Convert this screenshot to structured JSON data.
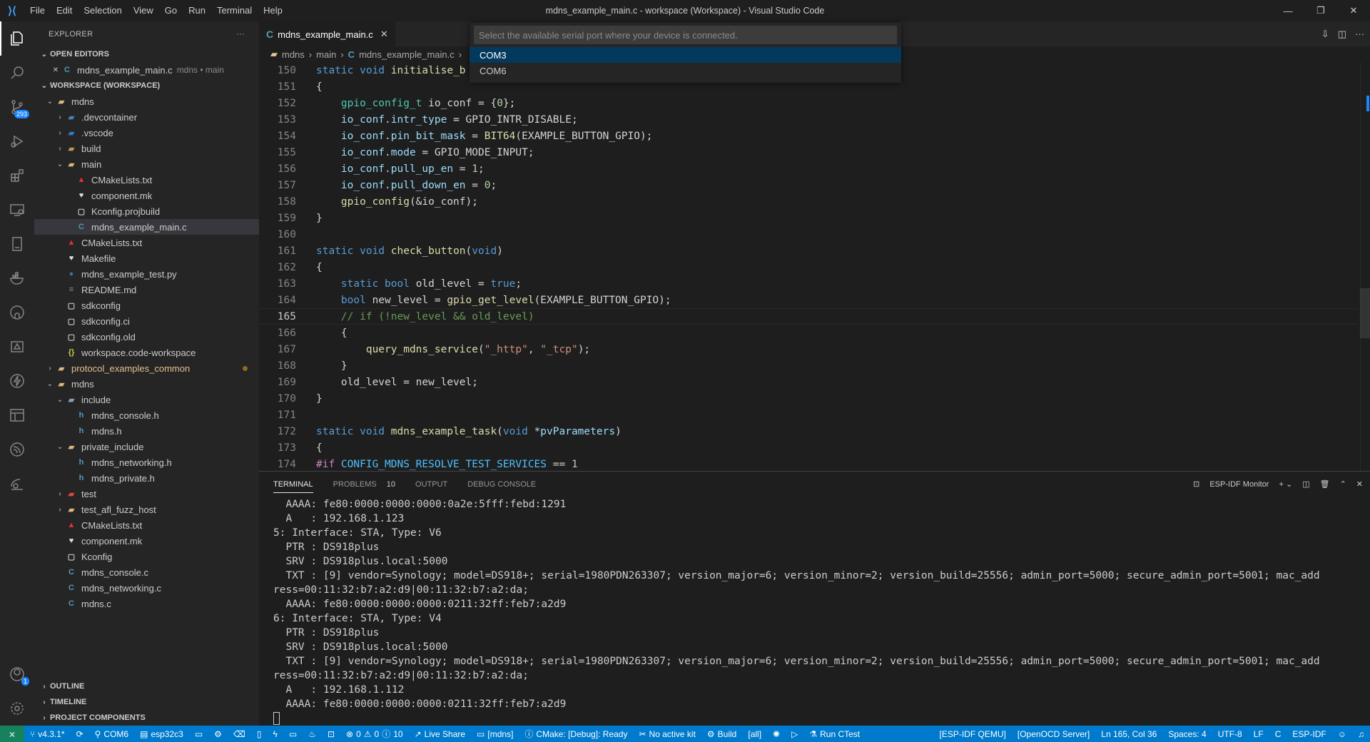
{
  "window": {
    "title": "mdns_example_main.c - workspace (Workspace) - Visual Studio Code",
    "menu": [
      "File",
      "Edit",
      "Selection",
      "View",
      "Go",
      "Run",
      "Terminal",
      "Help"
    ],
    "controls": [
      "—",
      "❐",
      "✕"
    ]
  },
  "activity": {
    "scm_badge": "293",
    "account_badge": "1"
  },
  "sidebar": {
    "title": "EXPLORER",
    "more": "···",
    "open_editors_label": "OPEN EDITORS",
    "open_editor": {
      "name": "mdns_example_main.c",
      "detail": "mdns • main"
    },
    "workspace_label": "WORKSPACE (WORKSPACE)",
    "tree": [
      {
        "label": "mdns",
        "indent": 1,
        "chev": "⌄",
        "icon": "folder-icon",
        "glyph": "▰",
        "color": "#dcb67a"
      },
      {
        "label": ".devcontainer",
        "indent": 2,
        "chev": "›",
        "icon": "folder-icon",
        "glyph": "▰",
        "color": "#4a7fbf"
      },
      {
        "label": ".vscode",
        "indent": 2,
        "chev": "›",
        "icon": "folder-icon",
        "glyph": "▰",
        "color": "#2f7bc6"
      },
      {
        "label": "build",
        "indent": 2,
        "chev": "›",
        "icon": "folder-icon",
        "glyph": "▰",
        "color": "#c09553"
      },
      {
        "label": "main",
        "indent": 2,
        "chev": "⌄",
        "icon": "folder-open-icon",
        "glyph": "▰",
        "color": "#dcb67a"
      },
      {
        "label": "CMakeLists.txt",
        "indent": 3,
        "chev": "",
        "icon": "cmake-icon",
        "glyph": "▲",
        "color": "#e4312a"
      },
      {
        "label": "component.mk",
        "indent": 3,
        "chev": "",
        "icon": "makefile-icon",
        "glyph": "♥",
        "color": "#e0e0e0"
      },
      {
        "label": "Kconfig.projbuild",
        "indent": 3,
        "chev": "",
        "icon": "file-icon",
        "glyph": "▢",
        "color": "#cccccc"
      },
      {
        "label": "mdns_example_main.c",
        "indent": 3,
        "chev": "",
        "icon": "c-file-icon",
        "glyph": "C",
        "color": "#519aba",
        "selected": true
      },
      {
        "label": "CMakeLists.txt",
        "indent": 2,
        "chev": "",
        "icon": "cmake-icon",
        "glyph": "▲",
        "color": "#e4312a"
      },
      {
        "label": "Makefile",
        "indent": 2,
        "chev": "",
        "icon": "makefile-icon",
        "glyph": "♥",
        "color": "#e0e0e0"
      },
      {
        "label": "mdns_example_test.py",
        "indent": 2,
        "chev": "",
        "icon": "python-icon",
        "glyph": "●",
        "color": "#3572a5"
      },
      {
        "label": "README.md",
        "indent": 2,
        "chev": "",
        "icon": "markdown-icon",
        "glyph": "≡",
        "color": "#8a8a8a"
      },
      {
        "label": "sdkconfig",
        "indent": 2,
        "chev": "",
        "icon": "file-icon",
        "glyph": "▢",
        "color": "#cccccc"
      },
      {
        "label": "sdkconfig.ci",
        "indent": 2,
        "chev": "",
        "icon": "file-icon",
        "glyph": "▢",
        "color": "#cccccc"
      },
      {
        "label": "sdkconfig.old",
        "indent": 2,
        "chev": "",
        "icon": "file-icon",
        "glyph": "▢",
        "color": "#cccccc"
      },
      {
        "label": "workspace.code-workspace",
        "indent": 2,
        "chev": "",
        "icon": "json-icon",
        "glyph": "{}",
        "color": "#cbcb41"
      },
      {
        "label": "protocol_examples_common",
        "indent": 1,
        "chev": "›",
        "icon": "folder-icon",
        "glyph": "▰",
        "color": "#dcb67a",
        "modified": true
      },
      {
        "label": "mdns",
        "indent": 1,
        "chev": "⌄",
        "icon": "folder-icon",
        "glyph": "▰",
        "color": "#dcb67a"
      },
      {
        "label": "include",
        "indent": 2,
        "chev": "⌄",
        "icon": "folder-open-icon",
        "glyph": "▰",
        "color": "#8aa0b8"
      },
      {
        "label": "mdns_console.h",
        "indent": 3,
        "chev": "",
        "icon": "h-file-icon",
        "glyph": "h",
        "color": "#519aba"
      },
      {
        "label": "mdns.h",
        "indent": 3,
        "chev": "",
        "icon": "h-file-icon",
        "glyph": "h",
        "color": "#519aba"
      },
      {
        "label": "private_include",
        "indent": 2,
        "chev": "⌄",
        "icon": "folder-open-icon",
        "glyph": "▰",
        "color": "#dcb67a"
      },
      {
        "label": "mdns_networking.h",
        "indent": 3,
        "chev": "",
        "icon": "h-file-icon",
        "glyph": "h",
        "color": "#519aba"
      },
      {
        "label": "mdns_private.h",
        "indent": 3,
        "chev": "",
        "icon": "h-file-icon",
        "glyph": "h",
        "color": "#519aba"
      },
      {
        "label": "test",
        "indent": 2,
        "chev": "›",
        "icon": "test-folder-icon",
        "glyph": "▰",
        "color": "#e0483c"
      },
      {
        "label": "test_afl_fuzz_host",
        "indent": 2,
        "chev": "›",
        "icon": "folder-icon",
        "glyph": "▰",
        "color": "#dcb67a"
      },
      {
        "label": "CMakeLists.txt",
        "indent": 2,
        "chev": "",
        "icon": "cmake-icon",
        "glyph": "▲",
        "color": "#e4312a"
      },
      {
        "label": "component.mk",
        "indent": 2,
        "chev": "",
        "icon": "makefile-icon",
        "glyph": "♥",
        "color": "#e0e0e0"
      },
      {
        "label": "Kconfig",
        "indent": 2,
        "chev": "",
        "icon": "file-icon",
        "glyph": "▢",
        "color": "#cccccc"
      },
      {
        "label": "mdns_console.c",
        "indent": 2,
        "chev": "",
        "icon": "c-file-icon",
        "glyph": "C",
        "color": "#519aba"
      },
      {
        "label": "mdns_networking.c",
        "indent": 2,
        "chev": "",
        "icon": "c-file-icon",
        "glyph": "C",
        "color": "#519aba"
      },
      {
        "label": "mdns.c",
        "indent": 2,
        "chev": "",
        "icon": "c-file-icon",
        "glyph": "C",
        "color": "#519aba"
      }
    ],
    "bottom_sections": [
      "OUTLINE",
      "TIMELINE",
      "PROJECT COMPONENTS"
    ]
  },
  "editor": {
    "tab_label": "mdns_example_main.c",
    "breadcrumb": [
      "mdns",
      "main",
      "mdns_example_main.c"
    ],
    "quick_pick": {
      "placeholder": "Select the available serial port where your device is connected.",
      "items": [
        "COM3",
        "COM6"
      ]
    },
    "current_line": 165,
    "lines": [
      {
        "n": 150,
        "t": [
          [
            "kw",
            "static "
          ],
          [
            "kw",
            "void "
          ],
          [
            "fn",
            "initialise_b"
          ]
        ]
      },
      {
        "n": 151,
        "t": [
          [
            "wt",
            "{"
          ]
        ]
      },
      {
        "n": 152,
        "t": [
          [
            "wt",
            "    "
          ],
          [
            "ty",
            "gpio_config_t"
          ],
          [
            "wt",
            " io_conf = {"
          ],
          [
            "nu",
            "0"
          ],
          [
            "wt",
            "};"
          ]
        ]
      },
      {
        "n": 153,
        "t": [
          [
            "wt",
            "    "
          ],
          [
            "va",
            "io_conf"
          ],
          [
            "wt",
            "."
          ],
          [
            "va",
            "intr_type"
          ],
          [
            "wt",
            " = GPIO_INTR_DISABLE;"
          ]
        ]
      },
      {
        "n": 154,
        "t": [
          [
            "wt",
            "    "
          ],
          [
            "va",
            "io_conf"
          ],
          [
            "wt",
            "."
          ],
          [
            "va",
            "pin_bit_mask"
          ],
          [
            "wt",
            " = "
          ],
          [
            "fn",
            "BIT64"
          ],
          [
            "wt",
            "(EXAMPLE_BUTTON_GPIO);"
          ]
        ]
      },
      {
        "n": 155,
        "t": [
          [
            "wt",
            "    "
          ],
          [
            "va",
            "io_conf"
          ],
          [
            "wt",
            "."
          ],
          [
            "va",
            "mode"
          ],
          [
            "wt",
            " = GPIO_MODE_INPUT;"
          ]
        ]
      },
      {
        "n": 156,
        "t": [
          [
            "wt",
            "    "
          ],
          [
            "va",
            "io_conf"
          ],
          [
            "wt",
            "."
          ],
          [
            "va",
            "pull_up_en"
          ],
          [
            "wt",
            " = "
          ],
          [
            "nu",
            "1"
          ],
          [
            "wt",
            ";"
          ]
        ]
      },
      {
        "n": 157,
        "t": [
          [
            "wt",
            "    "
          ],
          [
            "va",
            "io_conf"
          ],
          [
            "wt",
            "."
          ],
          [
            "va",
            "pull_down_en"
          ],
          [
            "wt",
            " = "
          ],
          [
            "nu",
            "0"
          ],
          [
            "wt",
            ";"
          ]
        ]
      },
      {
        "n": 158,
        "t": [
          [
            "wt",
            "    "
          ],
          [
            "fn",
            "gpio_config"
          ],
          [
            "wt",
            "(&io_conf);"
          ]
        ]
      },
      {
        "n": 159,
        "t": [
          [
            "wt",
            "}"
          ]
        ]
      },
      {
        "n": 160,
        "t": [
          [
            "wt",
            ""
          ]
        ]
      },
      {
        "n": 161,
        "t": [
          [
            "kw",
            "static "
          ],
          [
            "kw",
            "void "
          ],
          [
            "fn",
            "check_button"
          ],
          [
            "wt",
            "("
          ],
          [
            "kw",
            "void"
          ],
          [
            "wt",
            ")"
          ]
        ]
      },
      {
        "n": 162,
        "t": [
          [
            "wt",
            "{"
          ]
        ]
      },
      {
        "n": 163,
        "t": [
          [
            "wt",
            "    "
          ],
          [
            "kw",
            "static "
          ],
          [
            "kw",
            "bool "
          ],
          [
            "wt",
            "old_level = "
          ],
          [
            "kw",
            "true"
          ],
          [
            "wt",
            ";"
          ]
        ]
      },
      {
        "n": 164,
        "t": [
          [
            "wt",
            "    "
          ],
          [
            "kw",
            "bool "
          ],
          [
            "wt",
            "new_level = "
          ],
          [
            "fn",
            "gpio_get_level"
          ],
          [
            "wt",
            "(EXAMPLE_BUTTON_GPIO);"
          ]
        ]
      },
      {
        "n": 165,
        "t": [
          [
            "wt",
            "    "
          ],
          [
            "cm",
            "// if (!new_level && old_level)"
          ]
        ]
      },
      {
        "n": 166,
        "t": [
          [
            "wt",
            "    {"
          ]
        ]
      },
      {
        "n": 167,
        "t": [
          [
            "wt",
            "        "
          ],
          [
            "fn",
            "query_mdns_service"
          ],
          [
            "wt",
            "("
          ],
          [
            "st",
            "\"_http\""
          ],
          [
            "wt",
            ", "
          ],
          [
            "st",
            "\"_tcp\""
          ],
          [
            "wt",
            ");"
          ]
        ]
      },
      {
        "n": 168,
        "t": [
          [
            "wt",
            "    }"
          ]
        ]
      },
      {
        "n": 169,
        "t": [
          [
            "wt",
            "    old_level = new_level;"
          ]
        ]
      },
      {
        "n": 170,
        "t": [
          [
            "wt",
            "}"
          ]
        ]
      },
      {
        "n": 171,
        "t": [
          [
            "wt",
            ""
          ]
        ]
      },
      {
        "n": 172,
        "t": [
          [
            "kw",
            "static "
          ],
          [
            "kw",
            "void "
          ],
          [
            "fn",
            "mdns_example_task"
          ],
          [
            "wt",
            "("
          ],
          [
            "kw",
            "void "
          ],
          [
            "wt",
            "*"
          ],
          [
            "va",
            "pvParameters"
          ],
          [
            "wt",
            ")"
          ]
        ]
      },
      {
        "n": 173,
        "t": [
          [
            "wt",
            "{"
          ]
        ]
      },
      {
        "n": 174,
        "t": [
          [
            "pp",
            "#if "
          ],
          [
            "ma",
            "CONFIG_MDNS_RESOLVE_TEST_SERVICES"
          ],
          [
            "wt",
            " == "
          ],
          [
            "nu",
            "1"
          ]
        ]
      }
    ]
  },
  "panel": {
    "tabs": [
      "TERMINAL",
      "PROBLEMS",
      "OUTPUT",
      "DEBUG CONSOLE"
    ],
    "problems_count": "10",
    "terminal_name": "ESP-IDF Monitor",
    "terminal_lines": [
      "  AAAA: fe80:0000:0000:0000:0a2e:5fff:febd:1291",
      "  A   : 192.168.1.123",
      "5: Interface: STA, Type: V6",
      "  PTR : DS918plus",
      "  SRV : DS918plus.local:5000",
      "  TXT : [9] vendor=Synology; model=DS918+; serial=1980PDN263307; version_major=6; version_minor=2; version_build=25556; admin_port=5000; secure_admin_port=5001; mac_add",
      "ress=00:11:32:b7:a2:d9|00:11:32:b7:a2:da;",
      "  AAAA: fe80:0000:0000:0000:0211:32ff:feb7:a2d9",
      "6: Interface: STA, Type: V4",
      "  PTR : DS918plus",
      "  SRV : DS918plus.local:5000",
      "  TXT : [9] vendor=Synology; model=DS918+; serial=1980PDN263307; version_major=6; version_minor=2; version_build=25556; admin_port=5000; secure_admin_port=5001; mac_add",
      "ress=00:11:32:b7:a2:d9|00:11:32:b7:a2:da;",
      "  A   : 192.168.1.112",
      "  AAAA: fe80:0000:0000:0000:0211:32ff:feb7:a2d9"
    ]
  },
  "status": {
    "branch": "v4.3.1*",
    "port": "COM6",
    "target": "esp32c3",
    "errors": "0",
    "warnings": "0",
    "infos": "10",
    "live_share": "Live Share",
    "project": "[mdns]",
    "cmake": "CMake: [Debug]: Ready",
    "kit": "No active kit",
    "build": "Build",
    "all": "[all]",
    "ctest": "Run CTest",
    "qemu": "[ESP-IDF QEMU]",
    "openocd": "[OpenOCD Server]",
    "position": "Ln 165, Col 36",
    "spaces": "Spaces: 4",
    "encoding": "UTF-8",
    "eol": "LF",
    "language": "C",
    "idf": "ESP-IDF"
  }
}
